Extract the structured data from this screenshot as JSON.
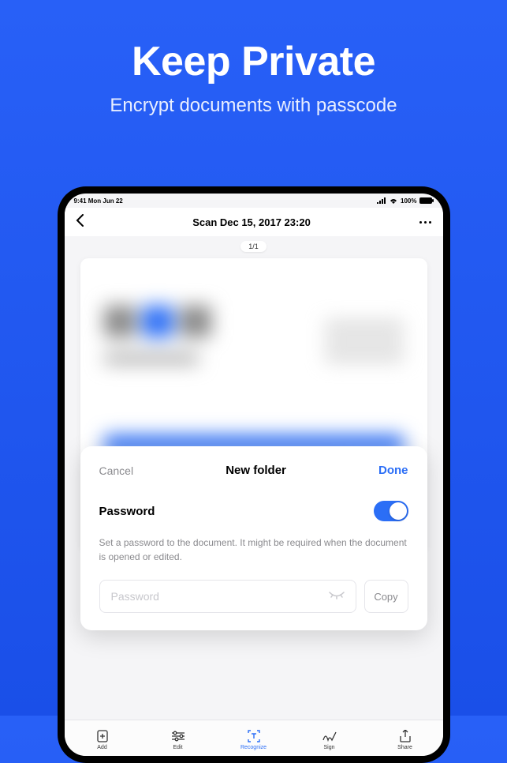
{
  "hero": {
    "title": "Keep Private",
    "subtitle": "Encrypt documents with passcode"
  },
  "status": {
    "time": "9:41",
    "date": "Mon Jun 22",
    "battery": "100%"
  },
  "nav": {
    "title": "Scan Dec 15, 2017 23:20"
  },
  "pager": {
    "label": "1/1"
  },
  "sheet": {
    "cancel": "Cancel",
    "title": "New folder",
    "done": "Done",
    "password_label": "Password",
    "password_on": true,
    "description": "Set a password to the document. It might be required when the document is opened or edited.",
    "input_placeholder": "Password",
    "copy_label": "Copy"
  },
  "tabs": {
    "items": [
      {
        "label": "Add"
      },
      {
        "label": "Edit"
      },
      {
        "label": "Recognize"
      },
      {
        "label": "Sign"
      },
      {
        "label": "Share"
      }
    ]
  }
}
